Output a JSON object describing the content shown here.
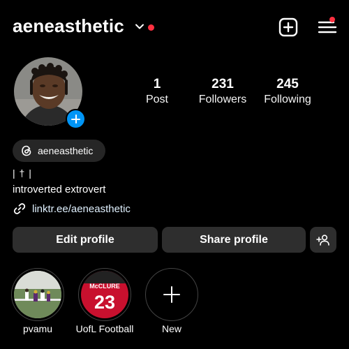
{
  "header": {
    "username": "aeneasthetic"
  },
  "stats": [
    {
      "value": "1",
      "label": "Post"
    },
    {
      "value": "231",
      "label": "Followers"
    },
    {
      "value": "245",
      "label": "Following"
    }
  ],
  "threads": {
    "handle": "aeneasthetic"
  },
  "bio": {
    "line1": "| † |",
    "line2": "introverted extrovert"
  },
  "link": {
    "text": "linktr.ee/aeneasthetic"
  },
  "buttons": {
    "edit": "Edit profile",
    "share": "Share profile"
  },
  "highlights": [
    {
      "label": "pvamu",
      "jersey": ""
    },
    {
      "label": "UofL Football",
      "jersey_name": "McCLURE",
      "jersey_number": "23"
    },
    {
      "label": "New"
    }
  ],
  "colors": {
    "accent_blue": "#0095f6",
    "notification_red": "#ff3040",
    "button_bg": "#2e2e2e"
  }
}
